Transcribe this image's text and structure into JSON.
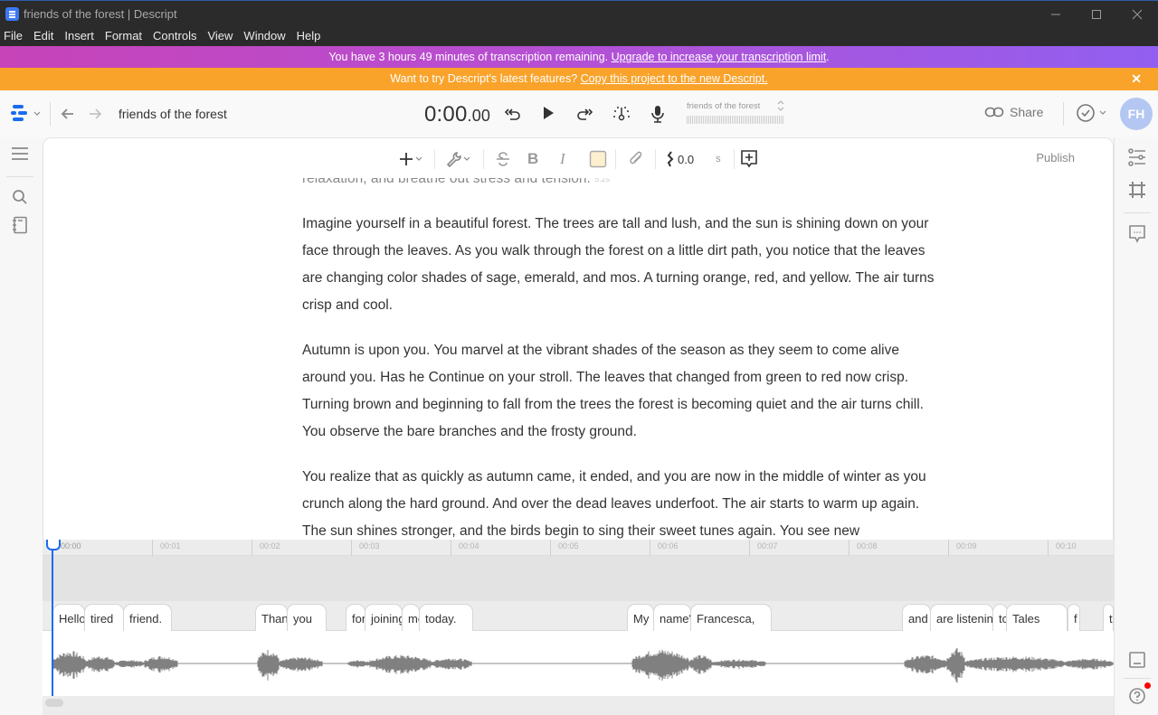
{
  "window": {
    "title": "friends of the forest | Descript",
    "controls": [
      "minimize-icon",
      "maximize-icon",
      "close-icon"
    ]
  },
  "menu": [
    "File",
    "Edit",
    "Insert",
    "Format",
    "Controls",
    "View",
    "Window",
    "Help"
  ],
  "banners": {
    "transcription": {
      "text": "You have 3 hours 49 minutes of transcription remaining. ",
      "link": "Upgrade to increase your transcription limit",
      "suffix": "."
    },
    "upgrade": {
      "text": "Want to try Descript's latest features? ",
      "link": "Copy this project to the new Descript.",
      "close": "✕"
    },
    "colors": {
      "purple": "#b64fd2",
      "orange": "#f9a32b"
    }
  },
  "topbar": {
    "project_title": "friends of the forest",
    "timecode_main": "0:00",
    "timecode_frac": ".00",
    "composition_name": "friends of the forest",
    "share_label": "Share",
    "avatar_initials": "FH",
    "accent": "#1a6cf0"
  },
  "toolbar": {
    "gap_value": "0.0",
    "gap_unit": "s",
    "publish_label": "Publish"
  },
  "document": {
    "paragraphs": [
      {
        "text": "relaxation, and breathe out stress and tension.",
        "gap_marker": "5.2s",
        "faded": true
      },
      {
        "text": "Imagine yourself in a beautiful forest. The trees are tall and lush, and the sun is shining down on your face through the leaves. As you walk through the forest on a little dirt path, you notice that the leaves are changing color shades of sage, emerald, and mos. A turning orange, red, and yellow. The air turns crisp and cool."
      },
      {
        "text": "Autumn is upon you. You marvel at the vibrant shades of the season as they seem to come alive around you. Has he Continue on your stroll. The leaves that changed from green to red now crisp. Turning brown and beginning to fall from the trees  the forest is becoming quiet and the air turns chill. You observe the bare branches and the frosty ground."
      },
      {
        "text": "You realize that as quickly as autumn came, it ended, and you are now in the middle of winter as you crunch along the hard ground. And over the dead leaves underfoot. The air starts to warm up again. The sun shines stronger, and the birds begin to sing their sweet tunes again. You see new"
      }
    ]
  },
  "timeline": {
    "ticks": [
      "00:00",
      "00:01",
      "00:02",
      "00:03",
      "00:04",
      "00:05",
      "00:06",
      "00:07",
      "00:08",
      "00:09",
      "00:10"
    ],
    "playhead_time": "00:00",
    "words": [
      "Hello",
      "tired",
      "friend.",
      "Thank",
      "you",
      "for",
      "joining",
      "me",
      "today.",
      "My",
      "name's",
      "Francesca,",
      "and",
      "are listening",
      "to",
      "Tales",
      "f",
      "t"
    ]
  }
}
